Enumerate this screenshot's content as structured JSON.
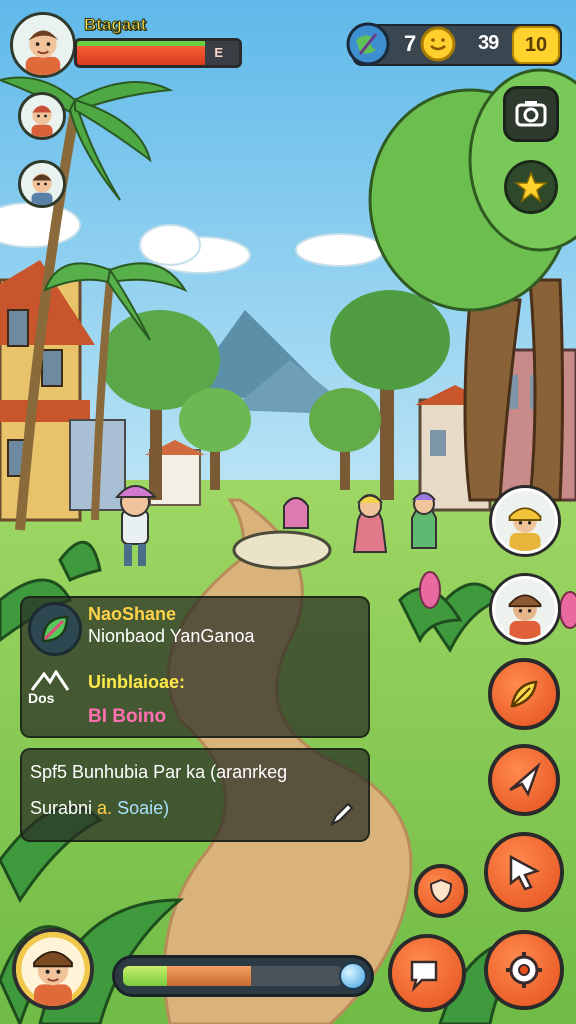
{
  "player": {
    "name": "Btagaat",
    "hp_value": "E",
    "hp_fraction": 0.79
  },
  "resources": {
    "stat_a": "7",
    "stat_b": "39",
    "gems": "10"
  },
  "quest": {
    "title": "NaoShane",
    "subtitle": "Nionbaod YanGanoa",
    "label": "Uinblaioae:",
    "reward": "BI Boino",
    "side_label": "Dos"
  },
  "message": {
    "line1": "Spf5  Bunhubia Par ka (aranrkeg",
    "line2_prefix": "Surabni ",
    "line2_highlight": "a.",
    "line2_suffix": " Soaie)"
  },
  "xp": {
    "green_fraction": 0.2,
    "orange_fraction": 0.38
  },
  "icons": {
    "camera": "camera-icon",
    "star": "star-icon",
    "globe": "globe-icon",
    "coin": "coin-icon",
    "edit": "pencil-icon",
    "quest": "leaf-icon",
    "actions": [
      "feather-icon",
      "paper-plane-icon",
      "cursor-icon",
      "shield-icon",
      "chat-bubble-icon",
      "settings-gear-icon"
    ]
  },
  "colors": {
    "accent": "#e4501d",
    "hp": "#d83a1b",
    "gold": "#ffd22e"
  }
}
